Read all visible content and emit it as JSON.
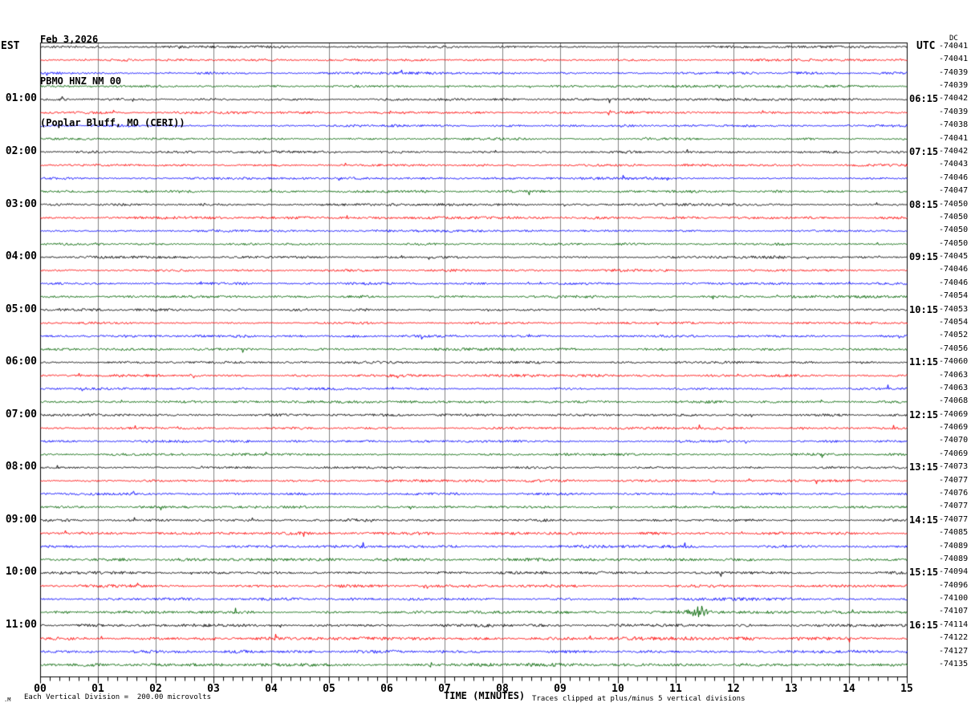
{
  "header": {
    "date_line": "Feb 3,2026",
    "station_line": "PBMO HNZ NM 00",
    "location_line": "(Poplar Bluff, MO (CERI))"
  },
  "axis": {
    "left_timezone": "EST",
    "right_timezone": "UTC",
    "dc_header": "DC",
    "x_axis_label": "TIME (MINUTES)",
    "minute_tick_labels": [
      "00",
      "01",
      "02",
      "03",
      "04",
      "05",
      "06",
      "07",
      "08",
      "09",
      "10",
      "11",
      "12",
      "13",
      "14",
      "15"
    ]
  },
  "footer": {
    "scale_text": "Each Vertical Division =  200.00 microvolts",
    "clip_text": "Traces clipped at plus/minus 5 vertical divisions",
    "corner_mark": ".M"
  },
  "chart_data": {
    "type": "line",
    "subtype": "helicorder",
    "title": "PBMO HNZ NM 00 (Poplar Bluff, MO (CERI)) Feb 3,2026",
    "xlabel": "TIME (MINUTES)",
    "x_range_minutes": [
      0,
      15
    ],
    "minutes_per_line": 15,
    "scale_microvolts_per_division": 200.0,
    "clip_divisions": 5,
    "grid": true,
    "grid_color": "#808080",
    "trace_color_cycle": [
      "#000000",
      "#ff0000",
      "#0000ff",
      "#006400"
    ],
    "rows": [
      {
        "left": "",
        "utc": "",
        "dc": "-74041"
      },
      {
        "left": "",
        "utc": "",
        "dc": "-74041"
      },
      {
        "left": "",
        "utc": "",
        "dc": "-74039"
      },
      {
        "left": "",
        "utc": "",
        "dc": "-74039"
      },
      {
        "left": "01:00",
        "utc": "06:15",
        "dc": "-74042"
      },
      {
        "left": "",
        "utc": "",
        "dc": "-74039"
      },
      {
        "left": "",
        "utc": "",
        "dc": "-74038"
      },
      {
        "left": "",
        "utc": "",
        "dc": "-74041"
      },
      {
        "left": "02:00",
        "utc": "07:15",
        "dc": "-74042"
      },
      {
        "left": "",
        "utc": "",
        "dc": "-74043"
      },
      {
        "left": "",
        "utc": "",
        "dc": "-74046"
      },
      {
        "left": "",
        "utc": "",
        "dc": "-74047"
      },
      {
        "left": "03:00",
        "utc": "08:15",
        "dc": "-74050"
      },
      {
        "left": "",
        "utc": "",
        "dc": "-74050"
      },
      {
        "left": "",
        "utc": "",
        "dc": "-74050"
      },
      {
        "left": "",
        "utc": "",
        "dc": "-74050"
      },
      {
        "left": "04:00",
        "utc": "09:15",
        "dc": "-74045"
      },
      {
        "left": "",
        "utc": "",
        "dc": "-74046"
      },
      {
        "left": "",
        "utc": "",
        "dc": "-74046"
      },
      {
        "left": "",
        "utc": "",
        "dc": "-74054"
      },
      {
        "left": "05:00",
        "utc": "10:15",
        "dc": "-74053"
      },
      {
        "left": "",
        "utc": "",
        "dc": "-74054"
      },
      {
        "left": "",
        "utc": "",
        "dc": "-74052"
      },
      {
        "left": "",
        "utc": "",
        "dc": "-74056"
      },
      {
        "left": "06:00",
        "utc": "11:15",
        "dc": "-74060"
      },
      {
        "left": "",
        "utc": "",
        "dc": "-74063"
      },
      {
        "left": "",
        "utc": "",
        "dc": "-74063"
      },
      {
        "left": "",
        "utc": "",
        "dc": "-74068"
      },
      {
        "left": "07:00",
        "utc": "12:15",
        "dc": "-74069"
      },
      {
        "left": "",
        "utc": "",
        "dc": "-74069"
      },
      {
        "left": "",
        "utc": "",
        "dc": "-74070"
      },
      {
        "left": "",
        "utc": "",
        "dc": "-74069"
      },
      {
        "left": "08:00",
        "utc": "13:15",
        "dc": "-74073"
      },
      {
        "left": "",
        "utc": "",
        "dc": "-74077"
      },
      {
        "left": "",
        "utc": "",
        "dc": "-74076"
      },
      {
        "left": "",
        "utc": "",
        "dc": "-74077"
      },
      {
        "left": "09:00",
        "utc": "14:15",
        "dc": "-74077"
      },
      {
        "left": "",
        "utc": "",
        "dc": "-74085"
      },
      {
        "left": "",
        "utc": "",
        "dc": "-74089"
      },
      {
        "left": "",
        "utc": "",
        "dc": "-74089"
      },
      {
        "left": "10:00",
        "utc": "15:15",
        "dc": "-74094"
      },
      {
        "left": "",
        "utc": "",
        "dc": "-74096"
      },
      {
        "left": "",
        "utc": "",
        "dc": "-74100"
      },
      {
        "left": "",
        "utc": "",
        "dc": "-74107"
      },
      {
        "left": "11:00",
        "utc": "16:15",
        "dc": "-74114"
      },
      {
        "left": "",
        "utc": "",
        "dc": "-74122"
      },
      {
        "left": "",
        "utc": "",
        "dc": "-74127"
      },
      {
        "left": "",
        "utc": "",
        "dc": "-74135"
      }
    ],
    "events": [
      {
        "row": 43,
        "minute": 11.15,
        "amplitude": 3.0,
        "width": 0.2,
        "note": "precursor wiggle on green trace"
      },
      {
        "row": 43,
        "minute": 11.42,
        "amplitude": 7.5,
        "width": 0.18,
        "note": "largest burst, green trace before 11:00 EST"
      },
      {
        "row": 34,
        "minute": 1.6,
        "amplitude": 4.0,
        "width": 0.02,
        "note": "blue spike"
      },
      {
        "row": 17,
        "minute": 5.3,
        "amplitude": 3.0,
        "width": 0.02,
        "note": "blue spike"
      },
      {
        "row": 17,
        "minute": 10.05,
        "amplitude": 3.5,
        "width": 0.02,
        "note": "blue spike"
      },
      {
        "row": 45,
        "minute": 7.4,
        "amplitude": 3.5,
        "width": 0.02,
        "note": "red spike"
      },
      {
        "row": 47,
        "minute": 6.75,
        "amplitude": 3.0,
        "width": 0.02,
        "note": "green spike"
      }
    ]
  }
}
